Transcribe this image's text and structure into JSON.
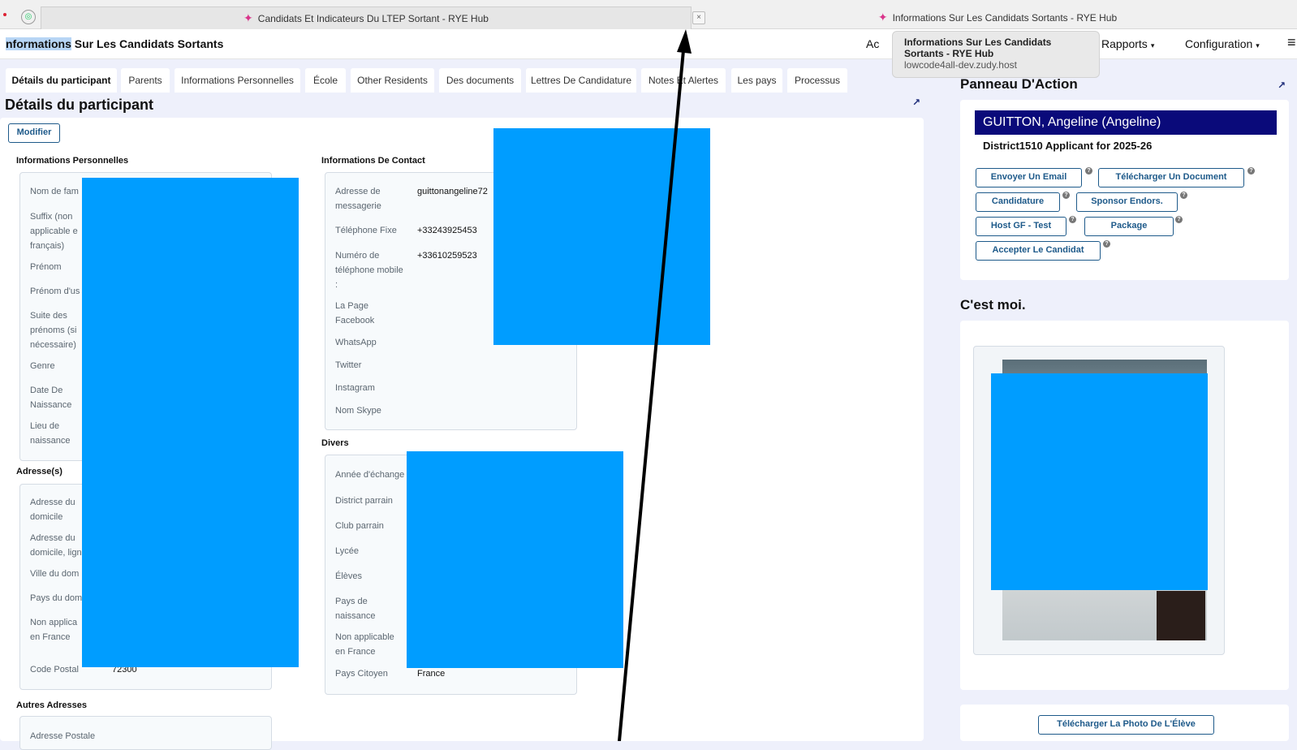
{
  "browser": {
    "tabs": [
      {
        "title": "Candidats Et Indicateurs Du LTEP Sortant - RYE Hub",
        "close_glyph": "×"
      },
      {
        "title": "Informations Sur Les Candidats Sortants - RYE Hub"
      }
    ]
  },
  "tooltip": {
    "title": "Informations Sur Les Candidats Sortants - RYE Hub",
    "url": "lowcode4all-dev.zudy.host"
  },
  "header": {
    "title_selected": "nformations",
    "title_rest": " Sur Les Candidats Sortants",
    "nav": [
      {
        "label": "Ac"
      },
      {
        "label": "Rapports",
        "caret": "▾"
      },
      {
        "label": "Configuration",
        "caret": "▾"
      }
    ],
    "menu_glyph": "≡"
  },
  "content_tabs": [
    "Détails du participant",
    "Parents",
    "Informations Personnelles",
    "École",
    "Other Residents",
    "Des documents",
    "Lettres De Candidature",
    "Notes Et Alertes",
    "Les pays",
    "Processus"
  ],
  "section": {
    "title": "Détails du participant",
    "modifier_label": "Modifier",
    "expand_glyph": "↗"
  },
  "personal_info": {
    "heading": "Informations Personnelles",
    "fields": [
      "Nom de fam",
      "Suffix (non applicable e français)",
      "Prénom",
      "Prénom d'us",
      "Suite des prénoms (si nécessaire)",
      "Genre",
      "Date De Naissance",
      "Lieu de naissance"
    ]
  },
  "addresses": {
    "heading": "Adresse(s)",
    "fields": [
      "Adresse du domicile",
      "Adresse du domicile, lign",
      "Ville du dom",
      "Pays du dom",
      "Non applica en France",
      "Code Postal"
    ],
    "code_postal_value": "72300"
  },
  "other_addresses": {
    "heading": "Autres Adresses",
    "fields": [
      "Adresse Postale"
    ]
  },
  "contact": {
    "heading": "Informations De Contact",
    "fields": [
      {
        "label": "Adresse de messagerie",
        "value": "guittonangeline72"
      },
      {
        "label": "Téléphone Fixe",
        "value": "+33243925453"
      },
      {
        "label": "Numéro de téléphone mobile :",
        "value": "+33610259523"
      },
      {
        "label": "La Page Facebook",
        "value": ""
      },
      {
        "label": "WhatsApp",
        "value": ""
      },
      {
        "label": "Twitter",
        "value": ""
      },
      {
        "label": "Instagram",
        "value": ""
      },
      {
        "label": "Nom Skype",
        "value": ""
      }
    ]
  },
  "divers": {
    "heading": "Divers",
    "fields": [
      "Année d'échange",
      "District parrain",
      "Club parrain",
      "Lycée",
      "Élèves",
      "Pays de naissance",
      "Non applicable en France",
      "Pays Citoyen"
    ],
    "pays_citoyen_value": "France"
  },
  "action_panel": {
    "title": "Panneau D'Action",
    "applicant_name": "GUITTON, Angeline (Angeline)",
    "applicant_sub": "District1510 Applicant for 2025-26",
    "buttons": [
      "Envoyer Un Email",
      "Télécharger Un Document",
      "Candidature",
      "Sponsor Endors.",
      "Host GF - Test",
      "Package",
      "Accepter Le Candidat"
    ],
    "help_glyph": "?"
  },
  "moi": {
    "title": "C'est moi.",
    "download_label": "Télécharger La Photo De L'Élève"
  },
  "colors": {
    "redaction": "#009dff",
    "brand_navy": "#0a0a7a",
    "button_blue": "#1e5a8a"
  }
}
